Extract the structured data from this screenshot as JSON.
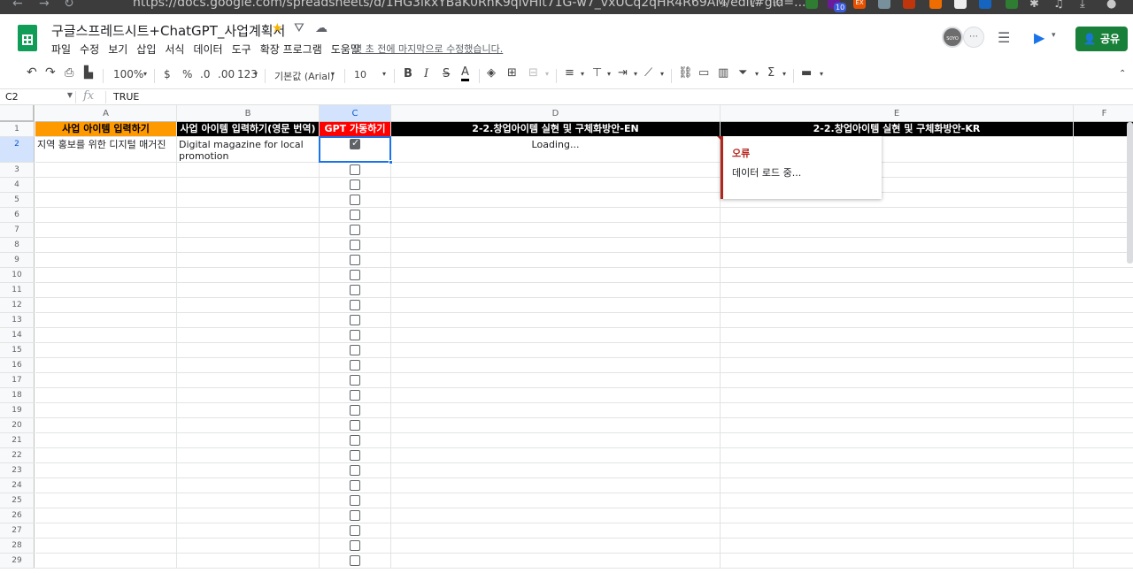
{
  "browser": {
    "url": "https://docs.google.com/spreadsheets/d/1HG3lkxYBaK0RhK9qlvHit71G-w7_vxUCq2qHR4R69AM/edit#gid=...",
    "ext_badge": "10",
    "ext_label": "EX"
  },
  "header": {
    "doc_title": "구글스프레드시트+ChatGPT_사업계획서",
    "menus": [
      "파일",
      "수정",
      "보기",
      "삽입",
      "서식",
      "데이터",
      "도구",
      "확장 프로그램",
      "도움말"
    ],
    "last_edit": "몇 초 전에 마지막으로 수정했습니다.",
    "share_label": "공유",
    "avatar_text": "SOYO"
  },
  "toolbar": {
    "zoom": "100%",
    "currency": "$",
    "percent": "%",
    "dec_less": ".0",
    "dec_more": ".00",
    "format_123": "123",
    "font": "기본값 (Arial)",
    "font_size": "10",
    "bold": "B",
    "italic": "I",
    "strike": "S",
    "text_color": "A",
    "sigma": "Σ"
  },
  "formula_bar": {
    "cell_ref": "C2",
    "fx": "fx",
    "value": "TRUE"
  },
  "columns": [
    "A",
    "B",
    "C",
    "D",
    "E",
    "F"
  ],
  "rows": [
    "1",
    "2",
    "3",
    "4",
    "5",
    "6",
    "7",
    "8",
    "9",
    "10",
    "11",
    "12",
    "13",
    "14",
    "15",
    "16",
    "17",
    "18",
    "19",
    "20",
    "21",
    "22",
    "23",
    "24",
    "25",
    "26",
    "27",
    "28",
    "29"
  ],
  "headers": {
    "A": "사업 아이템 입력하기",
    "B": "사업 아이템 입력하기(영문 번역)",
    "C": "GPT 가동하기",
    "D": "2-2.창업아이템 실현 및 구체화방안-EN",
    "E": "2-2.창업아이템 실현 및 구체화방안-KR"
  },
  "row2": {
    "A": "지역 홍보를 위한 디지털 매거진",
    "B": "Digital magazine for local promotion",
    "C_checked": true,
    "D": "Loading..."
  },
  "error_popup": {
    "title": "오류",
    "message": "데이터 로드 중..."
  },
  "colors": {
    "orange_header": "#ff9900",
    "red_header": "#ff0000",
    "black_header": "#000000",
    "share_green": "#188038",
    "error_red": "#b3261e"
  }
}
